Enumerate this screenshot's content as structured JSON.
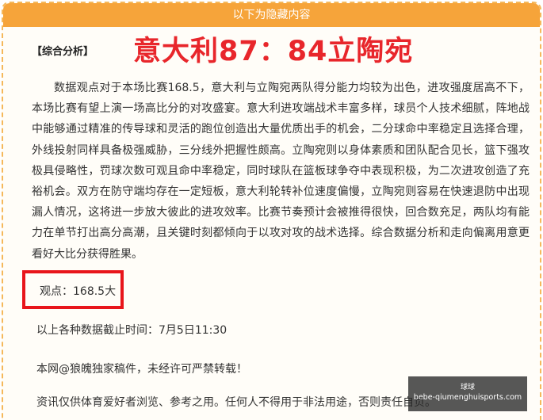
{
  "hidden_section": {
    "header": "以下为隐藏内容"
  },
  "article": {
    "section_label": "【综合分析】",
    "headline": "意大利87：84立陶宛",
    "body": "数据观点对于本场比赛168.5，意大利与立陶宛两队得分能力均较为出色，进攻强度居高不下，本场比赛有望上演一场高比分的对攻盛宴。意大利进攻端战术丰富多样，球员个人技术细腻，阵地战中能够通过精准的传导球和灵活的跑位创造出大量优质出手的机会，二分球命中率稳定且选择合理，外线投射同样具备极强威胁，三分线外把握性颇高。立陶宛则以身体素质和团队配合见长，篮下强攻极具侵略性，罚球次数可观且命中率稳定，同时球队在篮板球争夺中表现积极，为二次进攻创造了充裕机会。双方在防守端均存在一定短板，意大利轮转补位速度偏慢，立陶宛则容易在快速退防中出现漏人情况，这将进一步放大彼此的进攻效率。比赛节奏预计会被推得很快，回合数充足，两队均有能力在单节打出高分高潮，且关键时刻都倾向于以攻对攻的战术选择。综合数据分析和走向偏离用意更看好大比分获得胜果。",
    "view": "观点：168.5大",
    "cutoff": "以上各种数据截止时间：7月5日11:30",
    "copyright": "本网@狼魄独家稿件，未经许可严禁转载！",
    "disclaimer": "资讯仅供体育爱好者浏览、参考之用。任何人不得用于非法用途，否则责任自负。"
  },
  "watermark": {
    "top": "球球",
    "url": "bebe-qiumenghuisports.com"
  }
}
